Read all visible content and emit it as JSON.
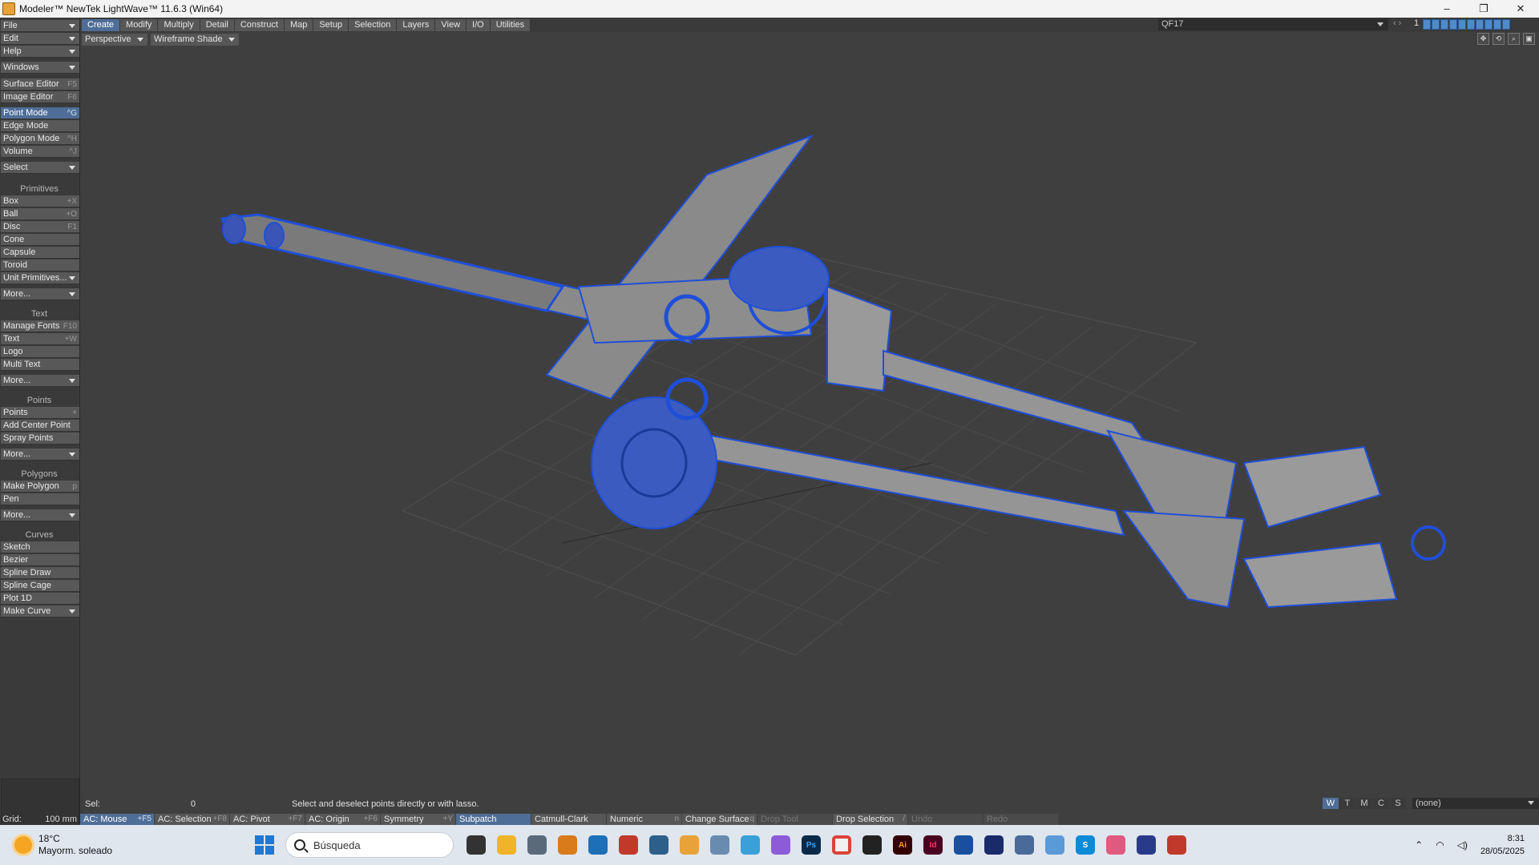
{
  "titlebar": {
    "title": "Modeler™ NewTek LightWave™ 11.6.3 (Win64)",
    "min": "–",
    "max": "❐",
    "close": "✕"
  },
  "sidebar": {
    "file": "File",
    "edit": "Edit",
    "help": "Help",
    "windows": "Windows",
    "surface_editor": {
      "label": "Surface Editor",
      "shortcut": "F5"
    },
    "image_editor": {
      "label": "Image Editor",
      "shortcut": "F6"
    },
    "point_mode": {
      "label": "Point Mode",
      "shortcut": "^G"
    },
    "edge_mode": {
      "label": "Edge Mode",
      "shortcut": ""
    },
    "polygon_mode": {
      "label": "Polygon Mode",
      "shortcut": "^H"
    },
    "volume": {
      "label": "Volume",
      "shortcut": "^J"
    },
    "select": "Select",
    "primitives_head": "Primitives",
    "box": {
      "label": "Box",
      "shortcut": "+X"
    },
    "ball": {
      "label": "Ball",
      "shortcut": "+O"
    },
    "disc": {
      "label": "Disc",
      "shortcut": "F1"
    },
    "cone": "Cone",
    "capsule": "Capsule",
    "toroid": "Toroid",
    "unit_primitives": "Unit Primitives...",
    "more1": "More...",
    "text_head": "Text",
    "manage_fonts": {
      "label": "Manage Fonts",
      "shortcut": "F10"
    },
    "text": {
      "label": "Text",
      "shortcut": "+W"
    },
    "logo": "Logo",
    "multi_text": "Multi Text",
    "more2": "More...",
    "points_head": "Points",
    "points": {
      "label": "Points",
      "shortcut": "+"
    },
    "add_center_point": "Add Center Point",
    "spray_points": "Spray Points",
    "more3": "More...",
    "polygons_head": "Polygons",
    "make_polygon": {
      "label": "Make Polygon",
      "shortcut": "p"
    },
    "pen": "Pen",
    "more4": "More...",
    "curves_head": "Curves",
    "sketch": "Sketch",
    "bezier": "Bezier",
    "spline_draw": "Spline Draw",
    "spline_cage": "Spline Cage",
    "plot_1d": "Plot 1D",
    "make_curve": "Make Curve"
  },
  "topmenu": {
    "tabs": [
      "Create",
      "Modify",
      "Multiply",
      "Detail",
      "Construct",
      "Map",
      "Setup",
      "Selection",
      "Layers",
      "View",
      "I/O",
      "Utilities"
    ],
    "layer_name": "QF17",
    "layer_number": "1"
  },
  "viewport_bar": {
    "view": "Perspective",
    "shading": "Wireframe Shade"
  },
  "status": {
    "sel_label": "Sel:",
    "sel_value": "0",
    "message": "Select and deselect points directly or with lasso.",
    "wtmcs": [
      "W",
      "T",
      "M",
      "C",
      "S"
    ],
    "surface": "(none)"
  },
  "bottombar": {
    "grid_label": "Grid:",
    "grid_value": "100 mm",
    "ac_mouse": {
      "label": "AC: Mouse",
      "shortcut": "+F5"
    },
    "ac_selection": {
      "label": "AC: Selection",
      "shortcut": "+F8"
    },
    "ac_pivot": {
      "label": "AC: Pivot",
      "shortcut": "+F7"
    },
    "ac_origin": {
      "label": "AC: Origin",
      "shortcut": "+F6"
    },
    "symmetry": {
      "label": "Symmetry",
      "shortcut": "+Y"
    },
    "subpatch": "Subpatch",
    "catmull": "Catmull-Clark",
    "numeric": {
      "label": "Numeric",
      "shortcut": "n"
    },
    "change_surface": {
      "label": "Change Surface",
      "shortcut": "q"
    },
    "drop_tool": "Drop Tool",
    "drop_selection": {
      "label": "Drop Selection",
      "shortcut": "/"
    },
    "undo": "Undo",
    "redo": "Redo"
  },
  "taskbar": {
    "temp": "18°C",
    "condition": "Mayorm. soleado",
    "search": "Búsqueda",
    "apps": [
      "Ps",
      "Ai",
      "Id",
      "S"
    ],
    "time": "8:31",
    "date": "28/05/2025"
  },
  "colors": {
    "accent": "#4f6e97",
    "wireframe": "#1f4fd8",
    "mesh": "#8a8a8a"
  }
}
